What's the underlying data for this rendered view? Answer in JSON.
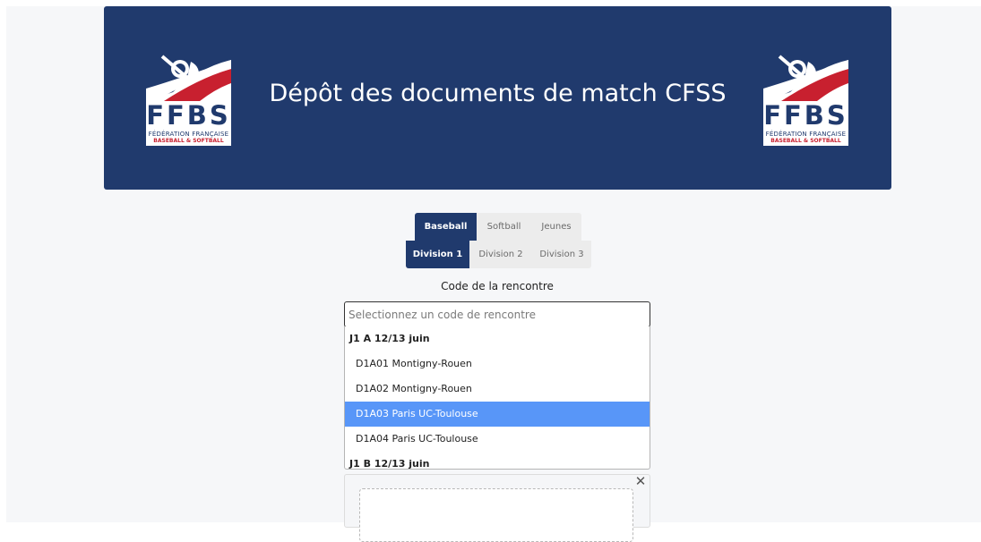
{
  "header": {
    "title": "Dépôt des documents de match CFSS",
    "logo_text": "FFBS",
    "logo_subtitle_1": "FÉDÉRATION FRANÇAISE",
    "logo_subtitle_2": "BASEBALL & SOFTBALL"
  },
  "sport_tabs": [
    {
      "label": "Baseball",
      "active": true
    },
    {
      "label": "Softball",
      "active": false
    },
    {
      "label": "Jeunes",
      "active": false
    }
  ],
  "division_tabs": [
    {
      "label": "Division 1",
      "active": true
    },
    {
      "label": "Division 2",
      "active": false
    },
    {
      "label": "Division 3",
      "active": false
    }
  ],
  "match_code": {
    "label": "Code de la rencontre",
    "placeholder": "Selectionnez un code de rencontre",
    "value": ""
  },
  "dropdown": {
    "groups": [
      {
        "label": "J1 A 12/13 juin",
        "options": [
          "D1A01 Montigny-Rouen",
          "D1A02 Montigny-Rouen",
          "D1A03 Paris UC-Toulouse",
          "D1A04 Paris UC-Toulouse"
        ]
      },
      {
        "label": "J1 B 12/13 juin",
        "options": []
      }
    ],
    "highlighted": "D1A03 Paris UC-Toulouse"
  },
  "upload": {
    "close_symbol": "✕"
  },
  "colors": {
    "header_bg": "#203a6d",
    "tab_active": "#203a6d",
    "tab_inactive": "#ececec",
    "option_highlight": "#5896f8",
    "brand_red": "#c8202f"
  }
}
